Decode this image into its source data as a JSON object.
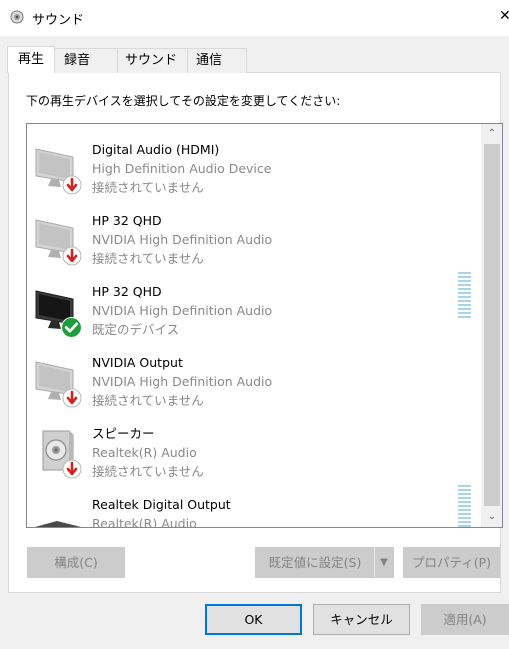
{
  "window": {
    "title": "サウンド"
  },
  "tabs": [
    {
      "label": "再生",
      "active": true
    },
    {
      "label": "録音",
      "active": false
    },
    {
      "label": "サウンド",
      "active": false
    },
    {
      "label": "通信",
      "active": false
    }
  ],
  "instruction": "下の再生デバイスを選択してその設定を変更してください:",
  "devices": [
    {
      "name": "Digital Audio (HDMI)",
      "description": "High Definition Audio Device",
      "status": "接続されていません",
      "icon": "monitor-icon",
      "badge": "disconnected-badge-icon"
    },
    {
      "name": "HP 32 QHD",
      "description": "NVIDIA High Definition Audio",
      "status": "接続されていません",
      "icon": "monitor-icon",
      "badge": "disconnected-badge-icon"
    },
    {
      "name": "HP 32 QHD",
      "description": "NVIDIA High Definition Audio",
      "status": "既定のデバイス",
      "icon": "monitor-icon",
      "badge": "default-check-badge-icon"
    },
    {
      "name": "NVIDIA Output",
      "description": "NVIDIA High Definition Audio",
      "status": "接続されていません",
      "icon": "monitor-icon",
      "badge": "disconnected-badge-icon"
    },
    {
      "name": "スピーカー",
      "description": "Realtek(R) Audio",
      "status": "接続されていません",
      "icon": "speaker-icon",
      "badge": "disconnected-badge-icon"
    },
    {
      "name": "Realtek Digital Output",
      "description": "Realtek(R) Audio",
      "status": "",
      "icon": "digital-output-icon",
      "badge": ""
    }
  ],
  "buttons": {
    "configure": "構成(C)",
    "set_default": "既定値に設定(S)",
    "properties": "プロパティ(P)",
    "ok": "OK",
    "cancel": "キャンセル",
    "apply": "適用(A)"
  },
  "colors": {
    "accent": "#0078d7",
    "check_green": "#1e9e3a",
    "disconnected_red": "#d32020",
    "meter": "#a9d4e6"
  }
}
